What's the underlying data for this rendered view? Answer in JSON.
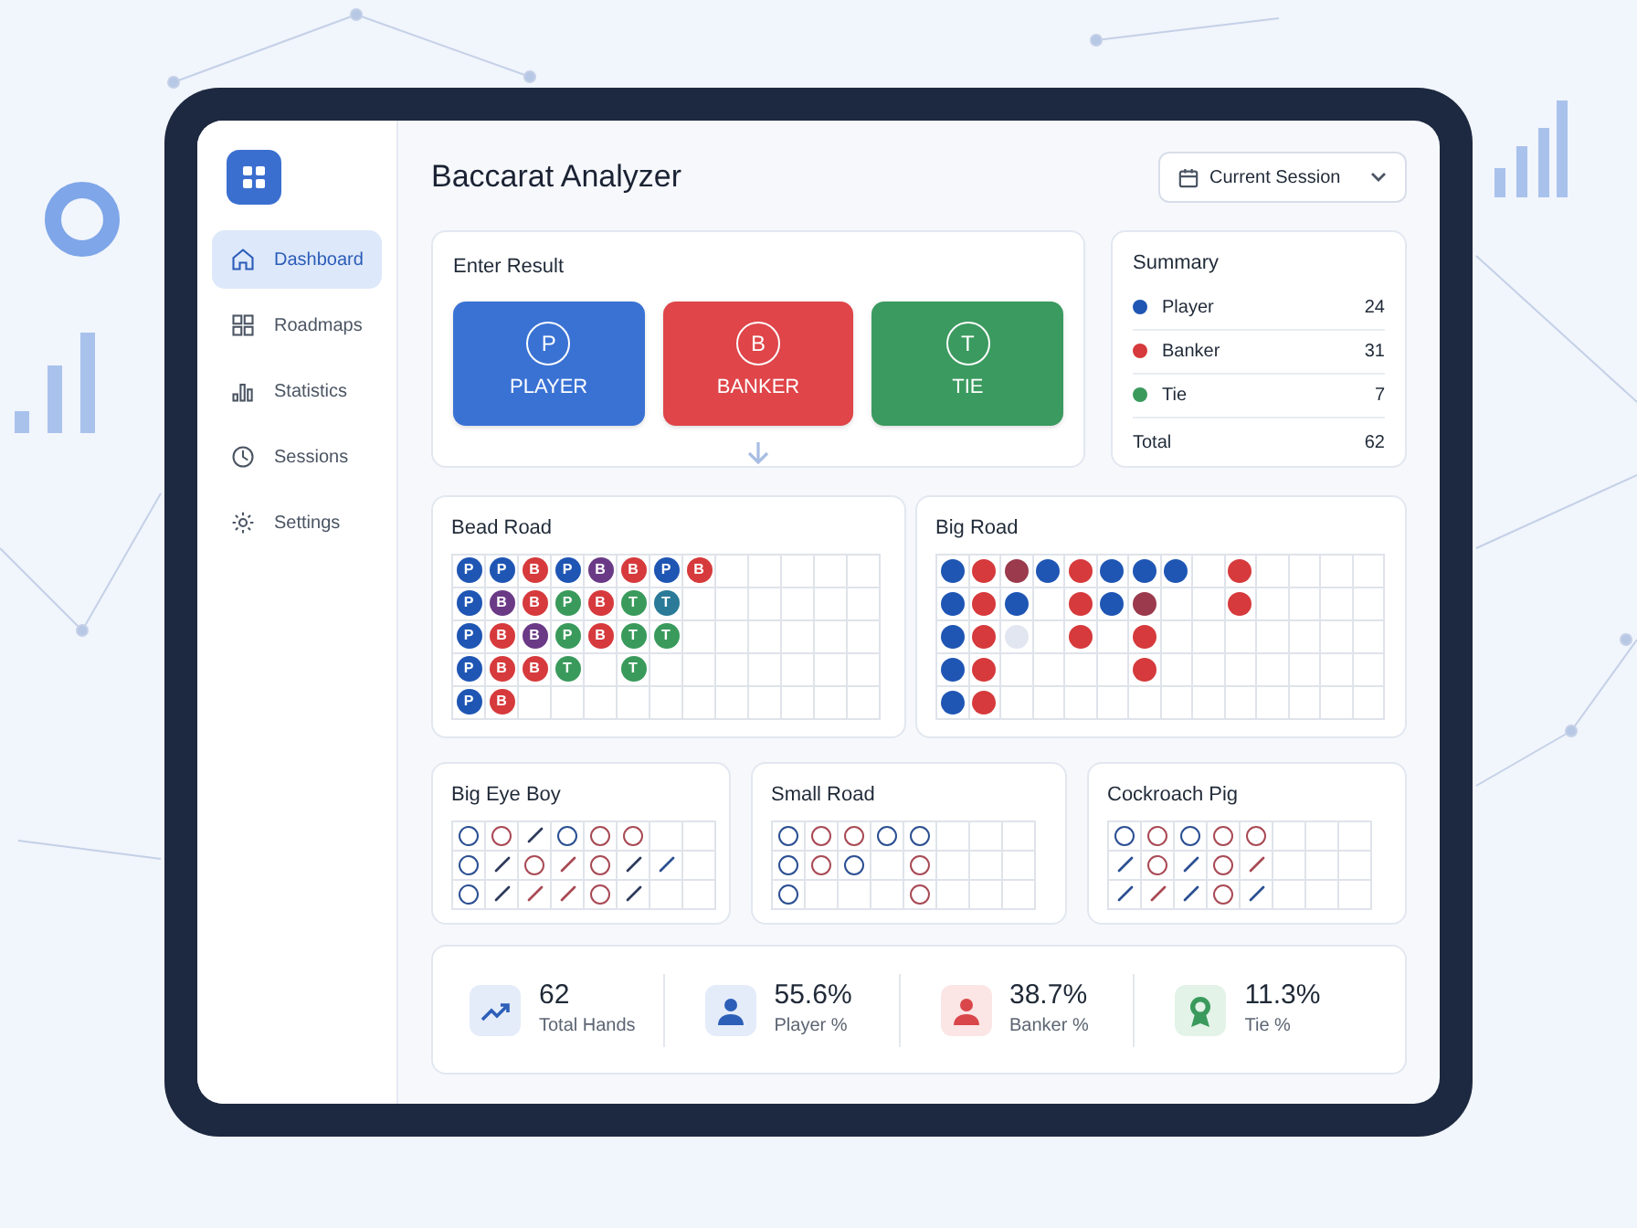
{
  "sidebar": {
    "items": [
      {
        "label": "Dashboard",
        "selected": true
      },
      {
        "label": "Roadmaps",
        "selected": false
      },
      {
        "label": "Statistics",
        "selected": false
      },
      {
        "label": "Sessions",
        "selected": false
      },
      {
        "label": "Settings",
        "selected": false
      }
    ]
  },
  "header": {
    "title": "Baccarat Analyzer",
    "session_dropdown": "Current Session"
  },
  "enter_result": {
    "title": "Enter Result",
    "buttons": [
      {
        "letter": "P",
        "label": "PLAYER",
        "color": "#3a72d4"
      },
      {
        "letter": "B",
        "label": "BANKER",
        "color": "#df4549"
      },
      {
        "letter": "T",
        "label": "TIE",
        "color": "#3b9a5f"
      }
    ]
  },
  "summary": {
    "title": "Summary",
    "rows": [
      {
        "label": "Player",
        "value": "24",
        "color": "#1f56b4"
      },
      {
        "label": "Banker",
        "value": "31",
        "color": "#d63a3c"
      },
      {
        "label": "Tie",
        "value": "7",
        "color": "#3a9a5c"
      }
    ],
    "total_label": "Total",
    "total_value": "62"
  },
  "bead_road": {
    "title": "Bead Road",
    "rows": [
      [
        {
          "text": "P",
          "color": "#1f56b4"
        },
        {
          "text": "P",
          "color": "#1f56b4"
        },
        {
          "text": "B",
          "color": "#d63a3c"
        },
        {
          "text": "P",
          "color": "#1f56b4"
        },
        {
          "text": "B",
          "color": "#6a3a86"
        },
        {
          "text": "B",
          "color": "#d63a3c"
        },
        {
          "text": "P",
          "color": "#1f56b4"
        },
        {
          "text": "B",
          "color": "#d63a3c"
        }
      ],
      [
        {
          "text": "P",
          "color": "#1f56b4"
        },
        {
          "text": "B",
          "color": "#6a3a86"
        },
        {
          "text": "B",
          "color": "#d63a3c"
        },
        {
          "text": "P",
          "color": "#3a9a5c"
        },
        {
          "text": "B",
          "color": "#d63a3c"
        },
        {
          "text": "T",
          "color": "#3a9a5c"
        },
        {
          "text": "T",
          "color": "#2a7a98"
        }
      ],
      [
        {
          "text": "P",
          "color": "#1f56b4"
        },
        {
          "text": "B",
          "color": "#d63a3c"
        },
        {
          "text": "B",
          "color": "#6a3a86"
        },
        {
          "text": "P",
          "color": "#3a9a5c"
        },
        {
          "text": "B",
          "color": "#d63a3c"
        },
        {
          "text": "T",
          "color": "#3a9a5c"
        },
        {
          "text": "T",
          "color": "#3a9a5c"
        }
      ],
      [
        {
          "text": "P",
          "color": "#1f56b4"
        },
        {
          "text": "B",
          "color": "#d63a3c"
        },
        {
          "text": "B",
          "color": "#d63a3c"
        },
        {
          "text": "T",
          "color": "#3a9a5c"
        },
        null,
        {
          "text": "T",
          "color": "#3a9a5c"
        }
      ],
      [
        {
          "text": "P",
          "color": "#1f56b4"
        },
        {
          "text": "B",
          "color": "#d63a3c"
        }
      ]
    ]
  },
  "big_road": {
    "title": "Big Road",
    "rows": [
      [
        {
          "color": "#1f56b4"
        },
        {
          "color": "#d63a3c"
        },
        {
          "color": "#9a3a4c"
        },
        {
          "color": "#1f56b4"
        },
        {
          "color": "#d63a3c"
        },
        {
          "color": "#1f56b4"
        },
        {
          "color": "#1f56b4"
        },
        {
          "color": "#1f56b4"
        },
        null,
        {
          "color": "#d63a3c"
        }
      ],
      [
        {
          "color": "#1f56b4"
        },
        {
          "color": "#d63a3c"
        },
        {
          "color": "#1f56b4"
        },
        null,
        {
          "color": "#d63a3c"
        },
        {
          "color": "#1f56b4"
        },
        {
          "color": "#9a3a4c"
        },
        null,
        null,
        {
          "color": "#d63a3c"
        }
      ],
      [
        {
          "color": "#1f56b4"
        },
        {
          "color": "#d63a3c"
        },
        {
          "color": "#e2e6f0"
        },
        null,
        {
          "color": "#d63a3c"
        },
        null,
        {
          "color": "#d63a3c"
        }
      ],
      [
        {
          "color": "#1f56b4"
        },
        {
          "color": "#d63a3c"
        },
        null,
        null,
        null,
        null,
        {
          "color": "#d63a3c"
        }
      ],
      [
        {
          "color": "#1f56b4"
        },
        {
          "color": "#d63a3c"
        }
      ]
    ]
  },
  "derived_roads": [
    {
      "title": "Big Eye Boy",
      "rows": [
        [
          {
            "kind": "circle",
            "color": "#2b4f92"
          },
          {
            "kind": "circle",
            "color": "#a84a55"
          },
          {
            "kind": "slash",
            "color": "#2e3a5c"
          },
          {
            "kind": "circle",
            "color": "#2b4f92"
          },
          {
            "kind": "circle",
            "color": "#a84a55"
          },
          {
            "kind": "circle",
            "color": "#a84a55"
          }
        ],
        [
          {
            "kind": "circle",
            "color": "#2b4f92"
          },
          {
            "kind": "slash",
            "color": "#2e3a5c"
          },
          {
            "kind": "circle",
            "color": "#a84a55"
          },
          {
            "kind": "slash",
            "color": "#a84a55"
          },
          {
            "kind": "circle",
            "color": "#a84a55"
          },
          {
            "kind": "slash",
            "color": "#2e3a5c"
          },
          {
            "kind": "slash",
            "color": "#2b4f92"
          }
        ],
        [
          {
            "kind": "circle",
            "color": "#2b4f92"
          },
          {
            "kind": "slash",
            "color": "#2e3a5c"
          },
          {
            "kind": "slash",
            "color": "#a84a55"
          },
          {
            "kind": "slash",
            "color": "#a84a55"
          },
          {
            "kind": "circle",
            "color": "#a84a55"
          },
          {
            "kind": "slash",
            "color": "#2e3a5c"
          }
        ]
      ]
    },
    {
      "title": "Small Road",
      "rows": [
        [
          {
            "kind": "circle",
            "color": "#2b4f92"
          },
          {
            "kind": "circle",
            "color": "#a84a55"
          },
          {
            "kind": "circle",
            "color": "#a84a55"
          },
          {
            "kind": "circle",
            "color": "#2b4f92"
          },
          {
            "kind": "circle",
            "color": "#2b4f92"
          }
        ],
        [
          {
            "kind": "circle",
            "color": "#2b4f92"
          },
          {
            "kind": "circle",
            "color": "#a84a55"
          },
          {
            "kind": "circle",
            "color": "#2b4f92"
          },
          null,
          {
            "kind": "circle",
            "color": "#a84a55"
          }
        ],
        [
          {
            "kind": "circle",
            "color": "#2b4f92"
          },
          null,
          null,
          null,
          {
            "kind": "circle",
            "color": "#a84a55"
          }
        ]
      ]
    },
    {
      "title": "Cockroach Pig",
      "rows": [
        [
          {
            "kind": "circle",
            "color": "#2b4f92"
          },
          {
            "kind": "circle",
            "color": "#a84a55"
          },
          {
            "kind": "circle",
            "color": "#2b4f92"
          },
          {
            "kind": "circle",
            "color": "#a84a55"
          },
          {
            "kind": "circle",
            "color": "#a84a55"
          }
        ],
        [
          {
            "kind": "slash",
            "color": "#2b4f92"
          },
          {
            "kind": "circle",
            "color": "#a84a55"
          },
          {
            "kind": "slash",
            "color": "#2b4f92"
          },
          {
            "kind": "circle",
            "color": "#a84a55"
          },
          {
            "kind": "slash",
            "color": "#a84a55"
          }
        ],
        [
          {
            "kind": "slash",
            "color": "#2b4f92"
          },
          {
            "kind": "slash",
            "color": "#a84a55"
          },
          {
            "kind": "slash",
            "color": "#2b4f92"
          },
          {
            "kind": "circle",
            "color": "#a84a55"
          },
          {
            "kind": "slash",
            "color": "#2b4f92"
          }
        ]
      ]
    }
  ],
  "stats": [
    {
      "value": "62",
      "label": "Total Hands"
    },
    {
      "value": "55.6%",
      "label": "Player %"
    },
    {
      "value": "38.7%",
      "label": "Banker %"
    },
    {
      "value": "11.3%",
      "label": "Tie %"
    }
  ]
}
